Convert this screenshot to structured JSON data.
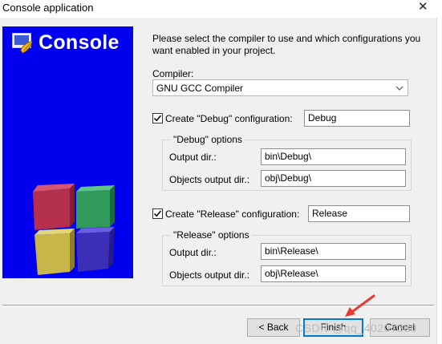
{
  "window": {
    "title": "Console application",
    "close_label": "✕"
  },
  "banner": {
    "title": "Console"
  },
  "intro_text": "Please select the compiler to use and which configurations you want enabled in your project.",
  "compiler": {
    "label": "Compiler:",
    "selected": "GNU GCC Compiler"
  },
  "debug": {
    "checkbox_label": "Create \"Debug\" configuration:",
    "checked": true,
    "name_value": "Debug",
    "group_title": "\"Debug\" options",
    "output_dir_label": "Output dir.:",
    "output_dir_value": "bin\\Debug\\",
    "objects_dir_label": "Objects output dir.:",
    "objects_dir_value": "obj\\Debug\\"
  },
  "release": {
    "checkbox_label": "Create \"Release\" configuration:",
    "checked": true,
    "name_value": "Release",
    "group_title": "\"Release\" options",
    "output_dir_label": "Output dir.:",
    "output_dir_value": "bin\\Release\\",
    "objects_dir_label": "Objects output dir.:",
    "objects_dir_value": "obj\\Release\\"
  },
  "buttons": {
    "back": "< Back",
    "finish": "Finish",
    "cancel": "Cancel"
  },
  "watermark": "CSDN @qq_40207380",
  "colors": {
    "banner": "#0000ee",
    "annotation_arrow": "#e8382f"
  }
}
